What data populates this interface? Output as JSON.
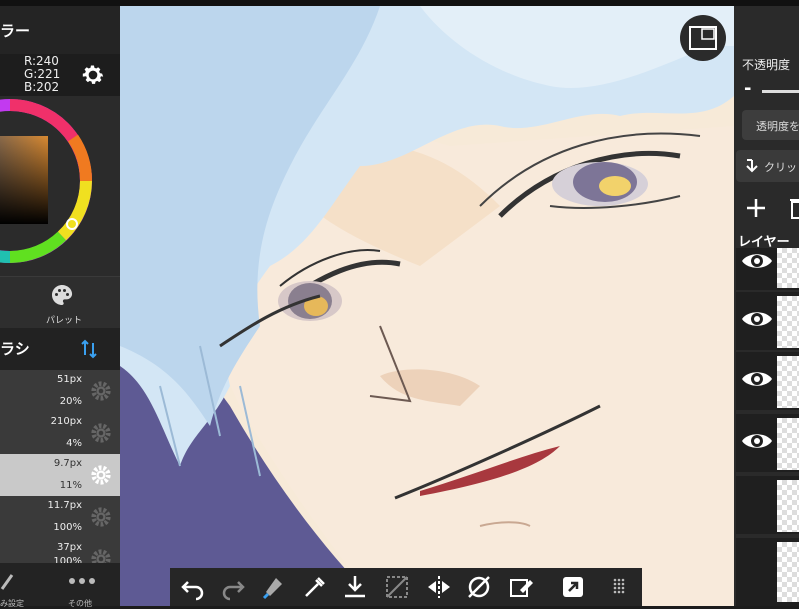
{
  "color_panel": {
    "title": "ラー",
    "rgb": {
      "r": "R:240",
      "g": "G:221",
      "b": "B:202"
    },
    "palette_label": "パレット"
  },
  "brush_panel": {
    "title": "ラシ",
    "rows": [
      {
        "size": "51px",
        "opacity": "20%"
      },
      {
        "size": "210px",
        "opacity": "4%"
      },
      {
        "size": "9.7px",
        "opacity": "11%"
      },
      {
        "size": "11.7px",
        "opacity": "100%"
      },
      {
        "size": "37px",
        "opacity": "100%"
      }
    ]
  },
  "left_bottom": {
    "settings_label": "み設定",
    "more_label": "その他"
  },
  "layer_panel": {
    "opacity_label": "不透明度",
    "lock_alpha_label": "透明度を",
    "clipping_label": "クリッ",
    "layers_title": "レイヤー"
  },
  "colors": {
    "current_color": "#f0ddca",
    "panel_bg": "#2b2b2b",
    "selected_row": "#c9c9c9",
    "hair": "#cfe2f2",
    "background_purple": "#5e5a94"
  },
  "icons": [
    "gear-icon",
    "palette-icon",
    "sort-icon",
    "undo-icon",
    "redo-icon",
    "fill-icon",
    "eyedropper-icon",
    "download-icon",
    "deselect-icon",
    "flip-icon",
    "rotate-icon",
    "clear-icon",
    "share-icon",
    "grid-icon",
    "eye-icon",
    "plus-icon",
    "trash-icon",
    "minimap-icon"
  ]
}
